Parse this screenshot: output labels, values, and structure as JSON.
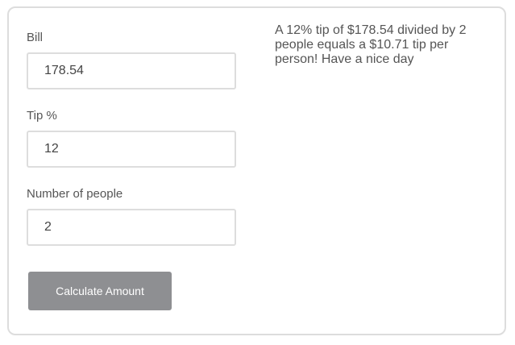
{
  "form": {
    "bill": {
      "label": "Bill",
      "value": "178.54"
    },
    "tip": {
      "label": "Tip %",
      "value": "12"
    },
    "people": {
      "label": "Number of people",
      "value": "2"
    },
    "calculate_label": "Calculate Amount"
  },
  "result": {
    "text": "A 12% tip of $178.54 divided by 2 people equals a $10.71 tip per person! Have a nice day"
  },
  "colors": {
    "button_bg": "#8e8f92",
    "border": "#dddddd",
    "text": "#555555"
  }
}
